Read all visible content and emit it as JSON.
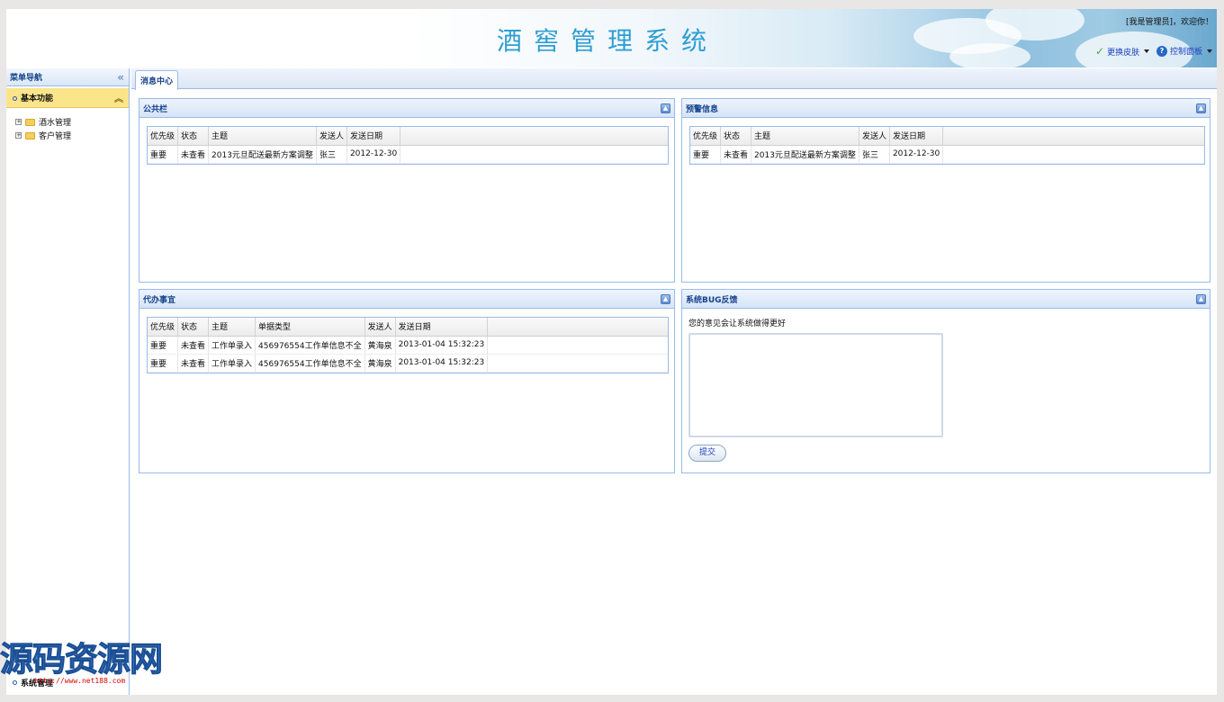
{
  "header": {
    "title": "酒窖管理系统",
    "greeting": "[我是管理员]，欢迎你！",
    "skin_label": "更换皮肤",
    "control_panel_label": "控制面板"
  },
  "sidebar": {
    "title": "菜单导航",
    "section": "基本功能",
    "items": [
      {
        "label": "酒水管理"
      },
      {
        "label": "客户管理"
      }
    ],
    "bottom_section": "系统管理"
  },
  "tabs": [
    {
      "label": "消息中心"
    }
  ],
  "panels": {
    "bulletin": {
      "title": "公共栏",
      "columns": [
        "优先级",
        "状态",
        "主题",
        "发送人",
        "发送日期"
      ],
      "rows": [
        [
          "重要",
          "未查看",
          "2013元旦配送最新方案调整",
          "张三",
          "2012-12-30"
        ]
      ]
    },
    "warning": {
      "title": "预警信息",
      "columns": [
        "优先级",
        "状态",
        "主题",
        "发送人",
        "发送日期"
      ],
      "rows": [
        [
          "重要",
          "未查看",
          "2013元旦配送最新方案调整",
          "张三",
          "2012-12-30"
        ]
      ]
    },
    "todo": {
      "title": "代办事宜",
      "columns": [
        "优先级",
        "状态",
        "主题",
        "单据类型",
        "发送人",
        "发送日期"
      ],
      "rows": [
        [
          "重要",
          "未查看",
          "工作单录入",
          "456976554工作单信息不全",
          "黄海泉",
          "2013-01-04 15:32:23"
        ],
        [
          "重要",
          "未查看",
          "工作单录入",
          "456976554工作单信息不全",
          "黄海泉",
          "2013-01-04 15:32:23"
        ]
      ]
    },
    "feedback": {
      "title": "系统BUG反馈",
      "prompt": "您的意见会让系统做得更好",
      "textarea_value": "",
      "submit_label": "提交"
    }
  },
  "watermark": {
    "text": "源码资源网",
    "url": "http://www.net188.com"
  },
  "colors": {
    "title_blue": "#2f9ed3",
    "panel_border": "#99bbe8",
    "panel_title": "#15428b",
    "accordion_active": "#fbe58a"
  }
}
